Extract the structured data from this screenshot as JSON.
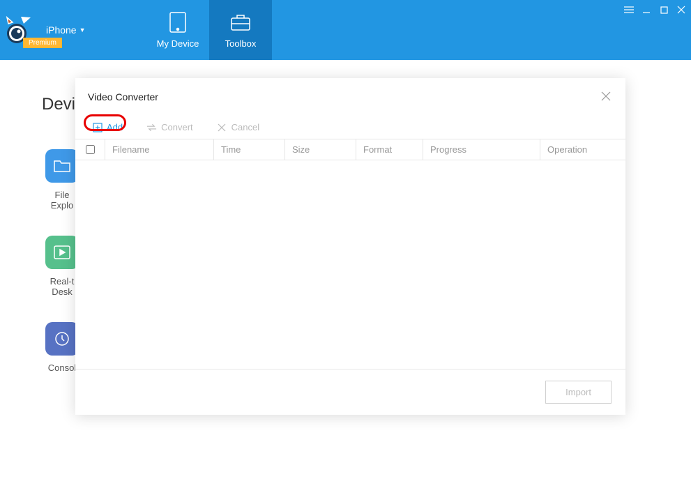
{
  "header": {
    "device_label": "iPhone",
    "premium_badge": "Premium",
    "tabs": [
      {
        "label": "My Device",
        "active": false
      },
      {
        "label": "Toolbox",
        "active": true
      }
    ]
  },
  "background": {
    "title": "Devic",
    "tiles": [
      {
        "label1": "File",
        "label2": "Explo",
        "color": "blue"
      },
      {
        "label1": "Real-t",
        "label2": "Desk",
        "color": "green"
      },
      {
        "label1": "Consol",
        "label2": "",
        "color": "darkblue"
      }
    ]
  },
  "modal": {
    "title": "Video Converter",
    "toolbar": {
      "add_label": "Add",
      "convert_label": "Convert",
      "cancel_label": "Cancel"
    },
    "columns": {
      "filename": "Filename",
      "time": "Time",
      "size": "Size",
      "format": "Format",
      "progress": "Progress",
      "operation": "Operation"
    },
    "import_label": "Import"
  }
}
